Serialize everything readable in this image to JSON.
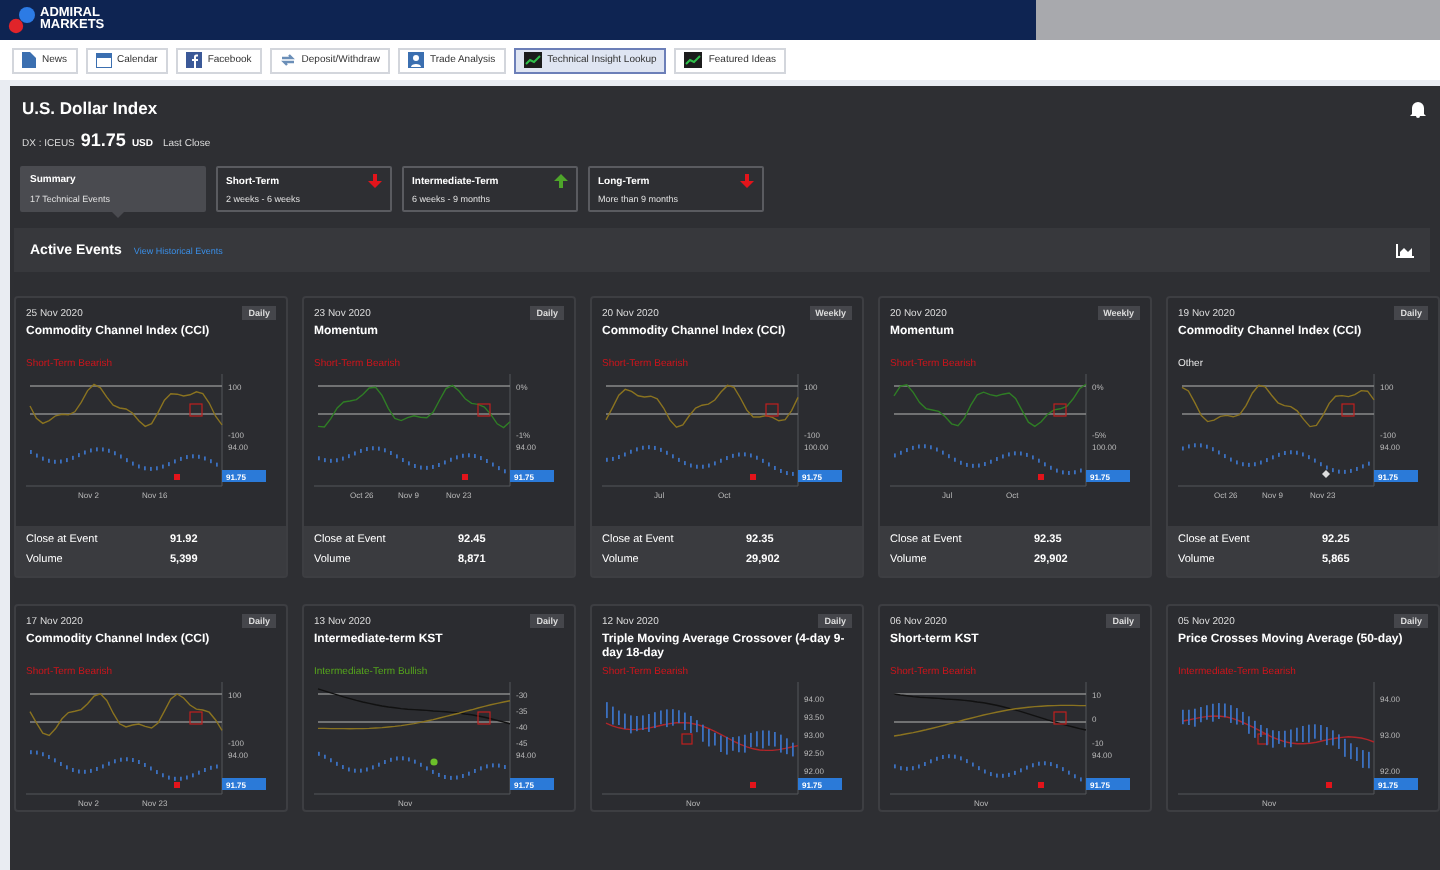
{
  "header": {
    "logo_line_1": "ADMIRAL",
    "logo_line_2": "MARKETS"
  },
  "toolbar": [
    {
      "label": "News",
      "kind": "doc",
      "selected": false
    },
    {
      "label": "Calendar",
      "kind": "calendar",
      "selected": false
    },
    {
      "label": "Facebook",
      "kind": "facebook",
      "selected": false
    },
    {
      "label": "Deposit/Withdraw",
      "kind": "swap",
      "selected": false
    },
    {
      "label": "Trade Analysis",
      "kind": "person",
      "selected": false
    },
    {
      "label": "Technical Insight Lookup",
      "kind": "chart",
      "selected": true
    },
    {
      "label": "Featured Ideas",
      "kind": "chart",
      "selected": false
    }
  ],
  "instrument": {
    "title": "U.S. Dollar Index",
    "symbol": "DX : ICEUS",
    "price": "91.75",
    "currency": "USD",
    "note": "Last Close"
  },
  "terms": [
    {
      "label": "Summary",
      "value": "17 Technical Events",
      "kind": "summary",
      "selected": true
    },
    {
      "label": "Short-Term",
      "value": "2 weeks - 6 weeks",
      "kind": "down",
      "selected": false
    },
    {
      "label": "Intermediate-Term",
      "value": "6 weeks - 9 months",
      "kind": "up",
      "selected": false
    },
    {
      "label": "Long-Term",
      "value": "More than 9 months",
      "kind": "down",
      "selected": false
    }
  ],
  "events_bar": {
    "title": "Active Events",
    "link": "View Historical Events"
  },
  "cards": [
    {
      "date": "25 Nov 2020",
      "frequency": "Daily",
      "title": "Commodity Channel Index (CCI)",
      "signal": "Short-Term Bearish",
      "kind": "bearish",
      "chart": {
        "kind": "cci",
        "y_labels": [
          "100",
          "-100",
          "94.00"
        ],
        "x_labels": [
          "Nov 2",
          "Nov 16"
        ],
        "price_tag": "91.75"
      },
      "stats": [
        {
          "label": "Close at Event",
          "value": "91.92"
        },
        {
          "label": "Volume",
          "value": "5,399"
        }
      ]
    },
    {
      "date": "23 Nov 2020",
      "frequency": "Daily",
      "title": "Momentum",
      "signal": "Short-Term Bearish",
      "kind": "bearish",
      "chart": {
        "kind": "momentum",
        "y_labels": [
          "0%",
          "-1%",
          "94.00"
        ],
        "x_labels": [
          "Oct 26",
          "Nov 9",
          "Nov 23"
        ],
        "price_tag": "91.75"
      },
      "stats": [
        {
          "label": "Close at Event",
          "value": "92.45"
        },
        {
          "label": "Volume",
          "value": "8,871"
        }
      ]
    },
    {
      "date": "20 Nov 2020",
      "frequency": "Weekly",
      "title": "Commodity Channel Index (CCI)",
      "signal": "Short-Term Bearish",
      "kind": "bearish",
      "chart": {
        "kind": "cci",
        "y_labels": [
          "100",
          "-100",
          "100.00"
        ],
        "x_labels": [
          "Jul",
          "Oct"
        ],
        "price_tag": "91.75"
      },
      "stats": [
        {
          "label": "Close at Event",
          "value": "92.35"
        },
        {
          "label": "Volume",
          "value": "29,902"
        }
      ]
    },
    {
      "date": "20 Nov 2020",
      "frequency": "Weekly",
      "title": "Momentum",
      "signal": "Short-Term Bearish",
      "kind": "bearish",
      "chart": {
        "kind": "momentum",
        "y_labels": [
          "0%",
          "-5%",
          "100.00"
        ],
        "x_labels": [
          "Jul",
          "Oct"
        ],
        "price_tag": "91.75"
      },
      "stats": [
        {
          "label": "Close at Event",
          "value": "92.35"
        },
        {
          "label": "Volume",
          "value": "29,902"
        }
      ]
    },
    {
      "date": "19 Nov 2020",
      "frequency": "Daily",
      "title": "Commodity Channel Index (CCI)",
      "signal": "Other",
      "kind": "other",
      "chart": {
        "kind": "cci",
        "y_labels": [
          "100",
          "-100",
          "94.00"
        ],
        "x_labels": [
          "Oct 26",
          "Nov 9",
          "Nov 23"
        ],
        "price_tag": "91.75"
      },
      "stats": [
        {
          "label": "Close at Event",
          "value": "92.25"
        },
        {
          "label": "Volume",
          "value": "5,865"
        }
      ]
    },
    {
      "date": "17 Nov 2020",
      "frequency": "Daily",
      "title": "Commodity Channel Index (CCI)",
      "signal": "Short-Term Bearish",
      "kind": "bearish",
      "chart": {
        "kind": "cci",
        "y_labels": [
          "100",
          "-100",
          "94.00"
        ],
        "x_labels": [
          "Nov 2",
          "Nov 23"
        ],
        "price_tag": "91.75"
      }
    },
    {
      "date": "13 Nov 2020",
      "frequency": "Daily",
      "title": "Intermediate-term KST",
      "signal": "Intermediate-Term Bullish",
      "kind": "bullish",
      "chart": {
        "kind": "kst",
        "y_labels": [
          "-30",
          "-35",
          "-40",
          "-45",
          "94.00"
        ],
        "x_labels": [
          "Nov"
        ],
        "price_tag": "91.75"
      }
    },
    {
      "date": "12 Nov 2020",
      "frequency": "Daily",
      "title": "Triple Moving Average Crossover (4-day 9-day 18-day",
      "signal": "Short-Term Bearish",
      "kind": "bearish",
      "chart": {
        "kind": "ma",
        "y_labels": [
          "94.00",
          "93.50",
          "93.00",
          "92.50",
          "92.00"
        ],
        "x_labels": [
          "Nov"
        ],
        "price_tag": "91.75"
      }
    },
    {
      "date": "06 Nov 2020",
      "frequency": "Daily",
      "title": "Short-term KST",
      "signal": "Short-Term Bearish",
      "kind": "bearish",
      "chart": {
        "kind": "kst",
        "y_labels": [
          "10",
          "0",
          "-10",
          "94.00"
        ],
        "x_labels": [
          "Nov"
        ],
        "price_tag": "91.75"
      }
    },
    {
      "date": "05 Nov 2020",
      "frequency": "Daily",
      "title": "Price Crosses Moving Average (50-day)",
      "signal": "Intermediate-Term Bearish",
      "kind": "bearish",
      "chart": {
        "kind": "ma",
        "y_labels": [
          "94.00",
          "93.00",
          "92.00"
        ],
        "x_labels": [
          "Nov"
        ],
        "price_tag": "91.75"
      }
    }
  ]
}
